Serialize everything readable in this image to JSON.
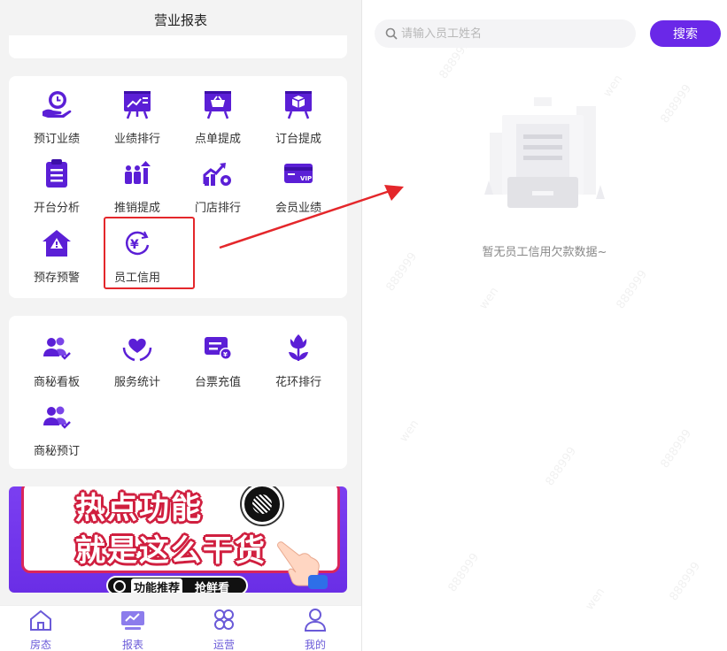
{
  "header": {
    "title": "营业报表"
  },
  "business_grid": {
    "items": [
      {
        "label": "预订业绩",
        "icon": "hand-clock-icon"
      },
      {
        "label": "业绩排行",
        "icon": "trend-board-icon"
      },
      {
        "label": "点单提成",
        "icon": "basket-board-icon"
      },
      {
        "label": "订台提成",
        "icon": "box-board-icon"
      },
      {
        "label": "开台分析",
        "icon": "clipboard-list-icon"
      },
      {
        "label": "推销提成",
        "icon": "people-chart-icon"
      },
      {
        "label": "门店排行",
        "icon": "chart-gear-icon"
      },
      {
        "label": "会员业绩",
        "icon": "vip-card-icon"
      },
      {
        "label": "预存预警",
        "icon": "house-alert-icon"
      },
      {
        "label": "员工信用",
        "icon": "yen-refresh-icon"
      }
    ]
  },
  "secretary_grid": {
    "items": [
      {
        "label": "商秘看板",
        "icon": "users-check-icon"
      },
      {
        "label": "服务统计",
        "icon": "heart-hands-icon"
      },
      {
        "label": "台票充值",
        "icon": "ticket-yen-icon"
      },
      {
        "label": "花环排行",
        "icon": "tulip-icon"
      },
      {
        "label": "商秘预订",
        "icon": "users-check-icon"
      }
    ]
  },
  "banner": {
    "line1": "热点功能",
    "line2": "就是这么干货",
    "pill_label": "功能推荐",
    "pill_action": "抢鲜看"
  },
  "nav": {
    "items": [
      {
        "label": "房态",
        "icon": "home-icon"
      },
      {
        "label": "报表",
        "icon": "report-icon"
      },
      {
        "label": "运营",
        "icon": "grid-icon"
      },
      {
        "label": "我的",
        "icon": "user-icon"
      }
    ]
  },
  "search": {
    "placeholder": "请输入员工姓名",
    "value": "",
    "button": "搜索"
  },
  "empty": {
    "text": "暂无员工信用欠款数据~"
  },
  "watermark": {
    "texts": [
      "888999",
      "wen"
    ]
  },
  "colors": {
    "accent": "#6a28e8",
    "icon": "#5b1fd6",
    "highlight": "#e4272b"
  }
}
